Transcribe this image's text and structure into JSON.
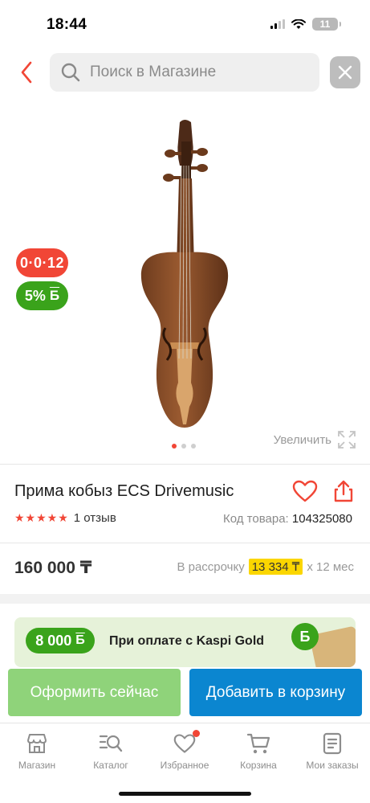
{
  "status_bar": {
    "time": "18:44",
    "battery": "11"
  },
  "search": {
    "placeholder": "Поиск в Магазине"
  },
  "gallery": {
    "promo_badge": "0·0·12",
    "bonus_badge": "5%",
    "bonus_currency": "Б",
    "zoom_label": "Увеличить",
    "slides": 3,
    "active_slide": 1
  },
  "product": {
    "title": "Прима кобыз ECS Drivemusic",
    "rating_stars": 5,
    "reviews": "1 отзыв",
    "sku_label": "Код товара:",
    "sku_value": "104325080",
    "price": "160 000 ₸",
    "installment_prefix": "В рассрочку",
    "installment_amount": "13 334 ₸",
    "installment_suffix": "x 12 мес"
  },
  "kaspi_gold": {
    "bonus": "8 000",
    "bonus_currency": "Б",
    "text": "При оплате с Kaspi Gold"
  },
  "actions": {
    "checkout_label": "Оформить сейчас",
    "add_to_cart_label": "Добавить в корзину"
  },
  "bottom_nav": {
    "items": [
      {
        "label": "Магазин",
        "icon": "store-icon"
      },
      {
        "label": "Каталог",
        "icon": "catalog-search-icon"
      },
      {
        "label": "Избранное",
        "icon": "heart-icon"
      },
      {
        "label": "Корзина",
        "icon": "cart-icon"
      },
      {
        "label": "Мои заказы",
        "icon": "orders-icon"
      }
    ]
  },
  "colors": {
    "accent_red": "#f14636",
    "bonus_green": "#3aa31b",
    "checkout_green": "#8fd37a",
    "cart_blue": "#0b86d0",
    "installment_yellow": "#fbd600"
  }
}
